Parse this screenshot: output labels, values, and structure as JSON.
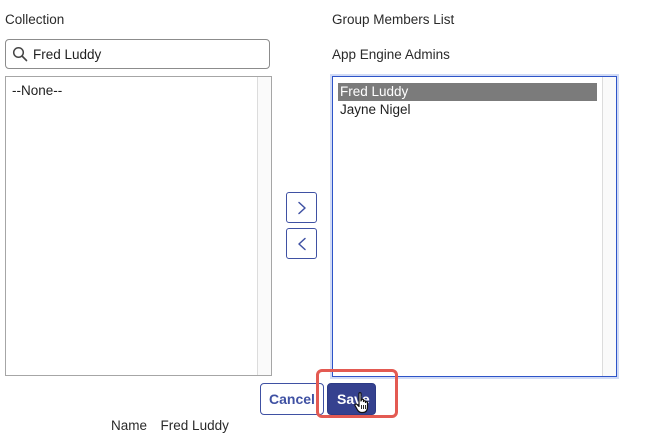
{
  "collection": {
    "label": "Collection",
    "search_value": "Fred Luddy",
    "list_items": [
      "--None--"
    ]
  },
  "group_members": {
    "label": "Group Members List",
    "group_name": "App Engine Admins",
    "list_items": [
      {
        "label": "Fred Luddy",
        "selected": true
      },
      {
        "label": "Jayne Nigel",
        "selected": false
      }
    ]
  },
  "buttons": {
    "add_icon": "chevron-right-icon",
    "remove_icon": "chevron-left-icon",
    "cancel_label": "Cancel",
    "save_label": "Save"
  },
  "footer": {
    "name_label": "Name",
    "name_value": "Fred Luddy"
  },
  "colors": {
    "accent": "#3f51a3",
    "save_bg": "#35418f",
    "highlight": "#e35a52",
    "selected_row": "#7b7b7b"
  }
}
